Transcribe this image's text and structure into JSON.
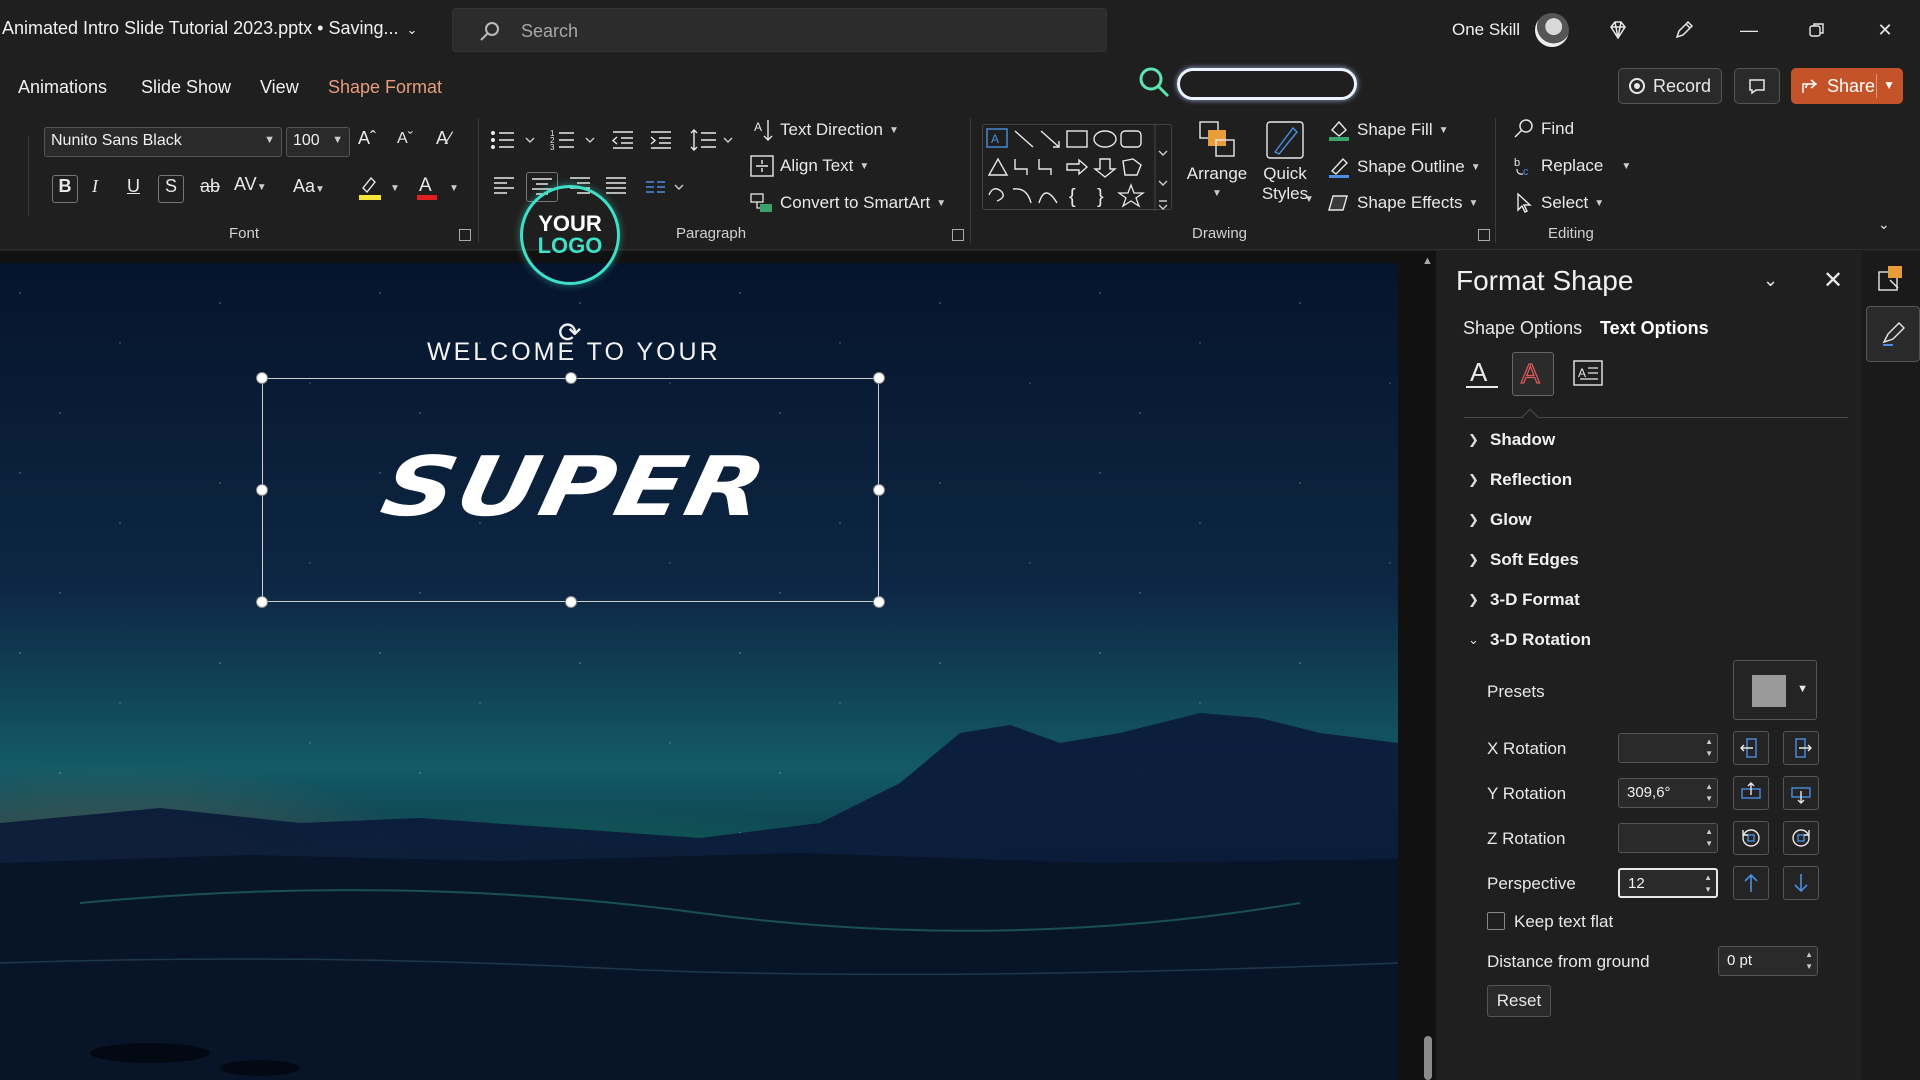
{
  "window": {
    "title": "Animated Intro Slide Tutorial 2023.pptx • Saving...",
    "search_placeholder": "Search",
    "user_name": "One Skill"
  },
  "menu": {
    "items": [
      "Animations",
      "Slide Show",
      "View",
      "Shape Format"
    ],
    "record_label": "Record",
    "share_label": "Share"
  },
  "ribbon": {
    "font": {
      "family": "Nunito Sans Black",
      "size": "100",
      "group_label": "Font"
    },
    "paragraph": {
      "text_direction": "Text Direction",
      "align_text": "Align Text",
      "convert_smartart": "Convert to SmartArt",
      "group_label": "Paragraph"
    },
    "drawing": {
      "arrange": "Arrange",
      "quick_styles_1": "Quick",
      "quick_styles_2": "Styles",
      "shape_fill": "Shape Fill",
      "shape_outline": "Shape Outline",
      "shape_effects": "Shape Effects",
      "group_label": "Drawing"
    },
    "editing": {
      "find": "Find",
      "replace": "Replace",
      "select": "Select",
      "group_label": "Editing"
    }
  },
  "slide": {
    "logo_line1": "YOUR",
    "logo_line2": "LOGO",
    "welcome": "WELCOME TO YOUR",
    "headline": "SUPER"
  },
  "format_pane": {
    "title": "Format Shape",
    "tabs": [
      "Shape Options",
      "Text Options"
    ],
    "active_tab": "Text Options",
    "sections": [
      "Shadow",
      "Reflection",
      "Glow",
      "Soft Edges",
      "3-D Format",
      "3-D Rotation"
    ],
    "rotation": {
      "presets_label": "Presets",
      "x_label": "X Rotation",
      "x_value": "",
      "y_label": "Y Rotation",
      "y_value": "309,6°",
      "z_label": "Z Rotation",
      "z_value": "",
      "perspective_label": "Perspective",
      "perspective_value": "12",
      "keep_flat_label": "Keep text flat",
      "keep_flat_checked": false,
      "distance_label": "Distance from ground",
      "distance_value": "0 pt",
      "reset_label": "Reset"
    }
  },
  "colors": {
    "accent_share": "#c4532a",
    "shape_format_tab": "#e89c7a",
    "logo_teal": "#3fe0c8"
  }
}
